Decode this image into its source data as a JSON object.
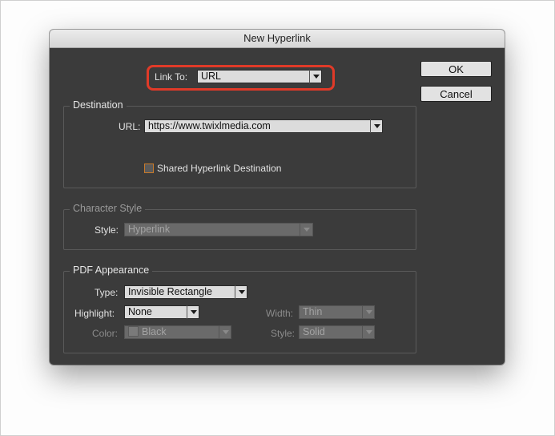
{
  "dialog": {
    "title": "New Hyperlink",
    "ok_label": "OK",
    "cancel_label": "Cancel"
  },
  "link_to": {
    "label": "Link To:",
    "value": "URL"
  },
  "destination": {
    "legend": "Destination",
    "url_label": "URL:",
    "url_value": "https://www.twixlmedia.com",
    "shared_label": "Shared Hyperlink Destination",
    "shared_checked": false
  },
  "character_style": {
    "legend": "Character Style",
    "style_label": "Style:",
    "style_value": "Hyperlink"
  },
  "pdf_appearance": {
    "legend": "PDF Appearance",
    "type_label": "Type:",
    "type_value": "Invisible Rectangle",
    "highlight_label": "Highlight:",
    "highlight_value": "None",
    "color_label": "Color:",
    "color_value": "Black",
    "width_label": "Width:",
    "width_value": "Thin",
    "style_label": "Style:",
    "style_value": "Solid"
  },
  "colors": {
    "dialog_bg": "#3b3b3b",
    "callout_ring": "#e03a28"
  }
}
